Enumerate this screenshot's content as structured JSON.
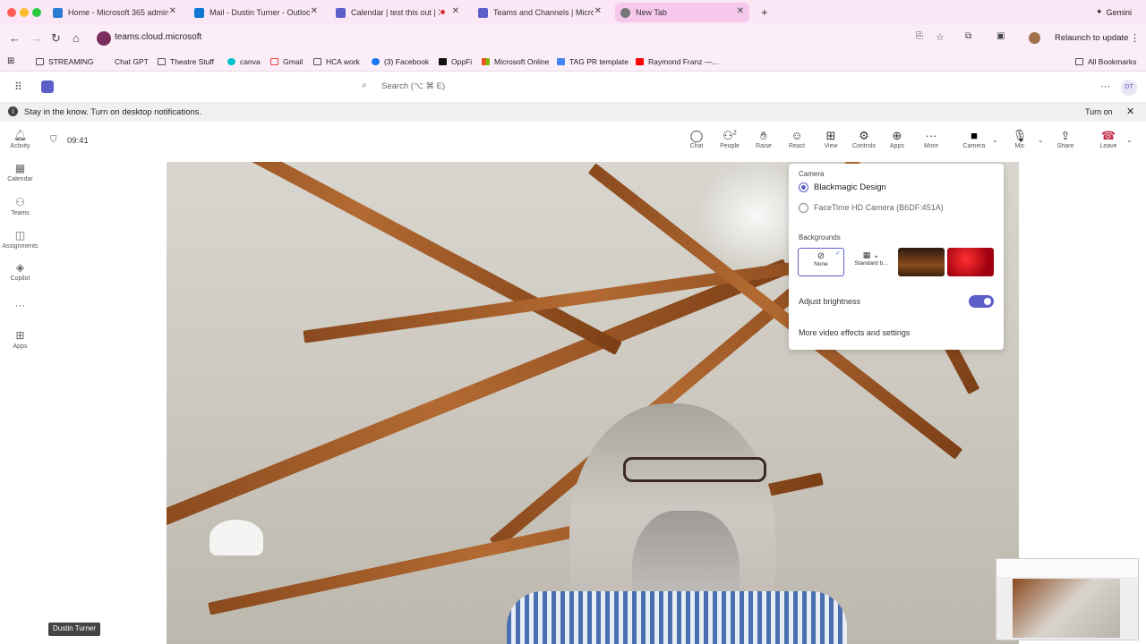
{
  "browser": {
    "tabs": [
      {
        "label": "Home - Microsoft 365 admin",
        "icon": "admin-icon"
      },
      {
        "label": "Mail - Dustin Turner - Outlook",
        "icon": "outlook-icon"
      },
      {
        "label": "Calendar | test this out | M",
        "icon": "teams-icon"
      },
      {
        "label": "Teams and Channels | Micros",
        "icon": "teams-icon"
      },
      {
        "label": "New Tab",
        "icon": "chrome-icon"
      }
    ],
    "new_tab_symbol": "+",
    "gemini_label": "Gemini",
    "url": "teams.cloud.microsoft",
    "relaunch_label": "Relaunch to update",
    "bookmarks": [
      "STREAMING",
      "Chat GPT",
      "Theatre Stuff",
      "canva",
      "Gmail",
      "HCA work",
      "(3) Facebook",
      "OppFi",
      "Microsoft Online",
      "TAG PR template",
      "Raymond Franz —..."
    ],
    "all_bookmarks_label": "All Bookmarks",
    "accent_color": "#f5c8ec"
  },
  "teams": {
    "search_placeholder": "Search (⌥ ⌘ E)",
    "avatar_initials": "DT",
    "notification": {
      "text": "Stay in the know. Turn on desktop notifications.",
      "action": "Turn on"
    },
    "rail": [
      {
        "label": "Activity",
        "icon": "bell-icon"
      },
      {
        "label": "Calendar",
        "icon": "calendar-icon"
      },
      {
        "label": "Teams",
        "icon": "teams-icon"
      },
      {
        "label": "Assignments",
        "icon": "assignments-icon"
      },
      {
        "label": "Copilot",
        "icon": "copilot-icon"
      },
      {
        "label": "",
        "icon": "more-icon"
      },
      {
        "label": "Apps",
        "icon": "apps-icon"
      }
    ],
    "meeting": {
      "timer": "09:41",
      "toolbar": [
        {
          "label": "Chat",
          "icon": "chat-icon"
        },
        {
          "label": "People",
          "icon": "people-icon",
          "count": "2"
        },
        {
          "label": "Raise",
          "icon": "raise-hand-icon"
        },
        {
          "label": "React",
          "icon": "react-icon"
        },
        {
          "label": "View",
          "icon": "view-icon"
        },
        {
          "label": "Controls",
          "icon": "controls-icon"
        },
        {
          "label": "Apps",
          "icon": "apps-icon"
        },
        {
          "label": "More",
          "icon": "more-icon"
        },
        {
          "label": "Camera",
          "icon": "camera-icon"
        },
        {
          "label": "Mic",
          "icon": "mic-icon"
        },
        {
          "label": "Share",
          "icon": "share-icon"
        },
        {
          "label": "Leave",
          "icon": "leave-icon"
        }
      ],
      "participant_name": "Dustin Turner"
    },
    "camera_panel": {
      "camera_heading": "Camera",
      "cameras": [
        {
          "label": "Blackmagic Design",
          "selected": true
        },
        {
          "label": "FaceTime HD Camera (B6DF:451A)",
          "selected": false
        }
      ],
      "backgrounds_heading": "Backgrounds",
      "backgrounds": [
        {
          "label": "None",
          "selected": true
        },
        {
          "label": "Standard b...",
          "selected": false
        },
        {
          "label": "",
          "selected": false
        },
        {
          "label": "",
          "selected": false
        }
      ],
      "adjust_brightness_label": "Adjust brightness",
      "adjust_brightness_on": true,
      "more_settings_label": "More video effects and settings",
      "accent_color": "#5b5fc7"
    }
  }
}
